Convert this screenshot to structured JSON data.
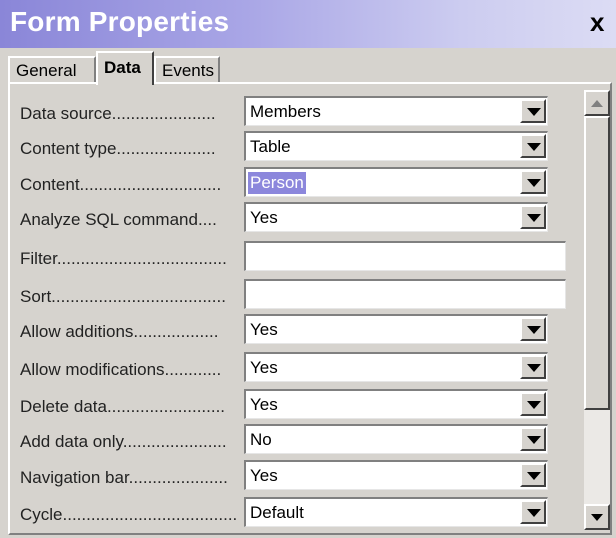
{
  "window": {
    "title": "Form Properties",
    "close_glyph": "x"
  },
  "tabs": [
    {
      "label": "General",
      "active": false
    },
    {
      "label": "Data",
      "active": true
    },
    {
      "label": "Events",
      "active": false
    }
  ],
  "properties": [
    {
      "label": "Data source......................",
      "value": "Members",
      "dropdown": true,
      "selected": false
    },
    {
      "label": "Content type.....................",
      "value": "Table",
      "dropdown": true,
      "selected": false
    },
    {
      "label": "Content..............................",
      "value": "Person",
      "dropdown": true,
      "selected": true
    },
    {
      "label": "Analyze SQL command....",
      "value": "Yes",
      "dropdown": true,
      "selected": false
    },
    {
      "label": "Filter....................................",
      "value": "",
      "dropdown": false,
      "selected": false
    },
    {
      "label": "Sort.....................................",
      "value": "",
      "dropdown": false,
      "selected": false
    },
    {
      "label": "Allow additions..................",
      "value": "Yes",
      "dropdown": true,
      "selected": false
    },
    {
      "label": "Allow modifications............",
      "value": "Yes",
      "dropdown": true,
      "selected": false
    },
    {
      "label": "Delete data.........................",
      "value": "Yes",
      "dropdown": true,
      "selected": false
    },
    {
      "label": "Add data only......................",
      "value": "No",
      "dropdown": true,
      "selected": false
    },
    {
      "label": "Navigation bar.....................",
      "value": "Yes",
      "dropdown": true,
      "selected": false
    },
    {
      "label": "Cycle.....................................",
      "value": "Default",
      "dropdown": true,
      "selected": false
    }
  ],
  "scrollbar": {
    "up_icon": "arrow-up-icon",
    "down_icon": "arrow-down-icon"
  },
  "colors": {
    "title_gradient_start": "#8a86d8",
    "selection": "#8c87dc",
    "face": "#d6d3ce"
  }
}
